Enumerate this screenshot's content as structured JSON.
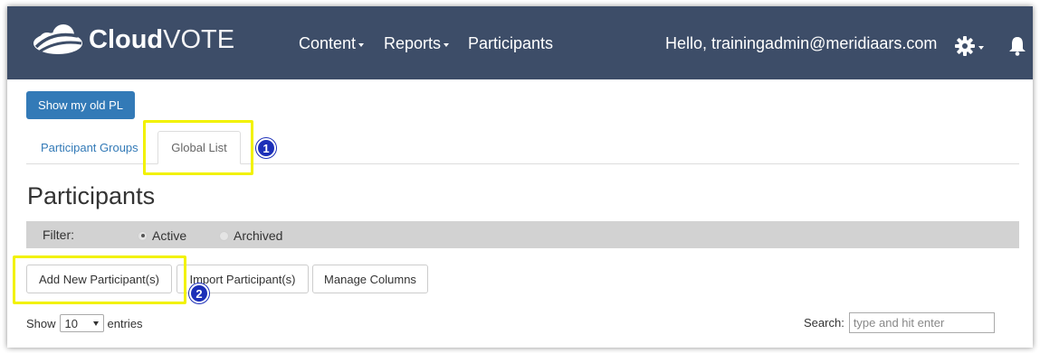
{
  "app": {
    "logo_bold": "Cloud",
    "logo_light": "VOTE"
  },
  "nav": {
    "items": [
      {
        "label": "Content",
        "dropdown": true
      },
      {
        "label": "Reports",
        "dropdown": true
      },
      {
        "label": "Participants",
        "dropdown": false
      }
    ],
    "greeting": "Hello, trainingadmin@meridiaars.com",
    "icons": [
      "gear-icon",
      "bell-icon"
    ]
  },
  "buttons": {
    "show_old_pl": "Show my old PL"
  },
  "tabs": [
    {
      "label": "Participant Groups",
      "active": false
    },
    {
      "label": "Global List",
      "active": true
    }
  ],
  "page": {
    "title": "Participants"
  },
  "filter": {
    "label": "Filter:",
    "options": [
      {
        "label": "Active",
        "selected": true
      },
      {
        "label": "Archived",
        "selected": false
      }
    ]
  },
  "actions": {
    "add": "Add New Participant(s)",
    "import": "Import Participant(s)",
    "manage": "Manage Columns"
  },
  "table_controls": {
    "show_prefix": "Show",
    "entries_value": "10",
    "show_suffix": "entries",
    "search_label": "Search:",
    "search_placeholder": "type and hit enter"
  },
  "annotations": {
    "badge_1": "1",
    "badge_2": "2"
  },
  "colors": {
    "navbar": "#3d4d68",
    "primary": "#337ab7",
    "highlight": "#f2f200",
    "badge": "#1c2fb8",
    "filter_bar": "#d2d2d2"
  }
}
